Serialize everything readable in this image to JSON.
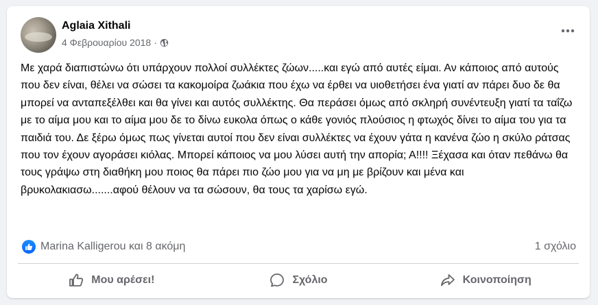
{
  "post": {
    "author": "Aglaia Xithali",
    "date": "4 Φεβρουαρίου 2018",
    "separator": "·",
    "audience_icon": "globe-icon",
    "more_icon": "more-dots-icon",
    "text": "Με χαρά διαπιστώνω ότι υπάρχουν πολλοί συλλέκτες ζώων.....και εγώ από αυτές είμαι. Αν κάποιος από αυτούς που δεν είναι, θέλει να σώσει τα κακομοίρα ζωάκια που έχω να έρθει να υιοθετήσει ένα γιατί αν πάρει δυο δε θα μπορεί να ανταπεξέλθει και θα γίνει και αυτός συλλέκτης. Θα περάσει όμως από σκληρή συνέντευξη γιατί τα ταΐζω με το αίμα μου και το αίμα μου δε το δίνω ευκολα όπως ο κάθε γονιός πλούσιος η φτωχός δίνει το αίμα του για τα παιδιά του. Δε ξέρω όμως πως γίνεται αυτοί που δεν είναι συλλέκτες να έχουν γάτα η κανένα ζώο η σκύλο ράτσας που τον έχουν αγοράσει κιόλας. Μπορεί κάποιος να μου λύσει αυτή την απορία; Α!!!! Ξέχασα και όταν πεθάνω θα τους γράψω στη διαθήκη μου ποιος θα πάρει πιο ζώο μου για να μη με βρίζουν και μένα και βρυκολακιασω.......αφού θέλουν να τα σώσουν, θα τους τα χαρίσω εγώ."
  },
  "reactions": {
    "icon": "like-badge-icon",
    "summary": "Marina Kalligerou και 8 ακόμη",
    "comments": "1 σχόλιο"
  },
  "actions": {
    "like": {
      "label": "Μου αρέσει!",
      "icon": "thumbs-up-icon"
    },
    "comment": {
      "label": "Σχόλιο",
      "icon": "comment-bubble-icon"
    },
    "share": {
      "label": "Κοινοποίηση",
      "icon": "share-arrow-icon"
    }
  },
  "colors": {
    "background": "#f0f2f5",
    "card": "#ffffff",
    "text": "#050505",
    "secondary": "#65676b",
    "accent": "#0866ff"
  }
}
